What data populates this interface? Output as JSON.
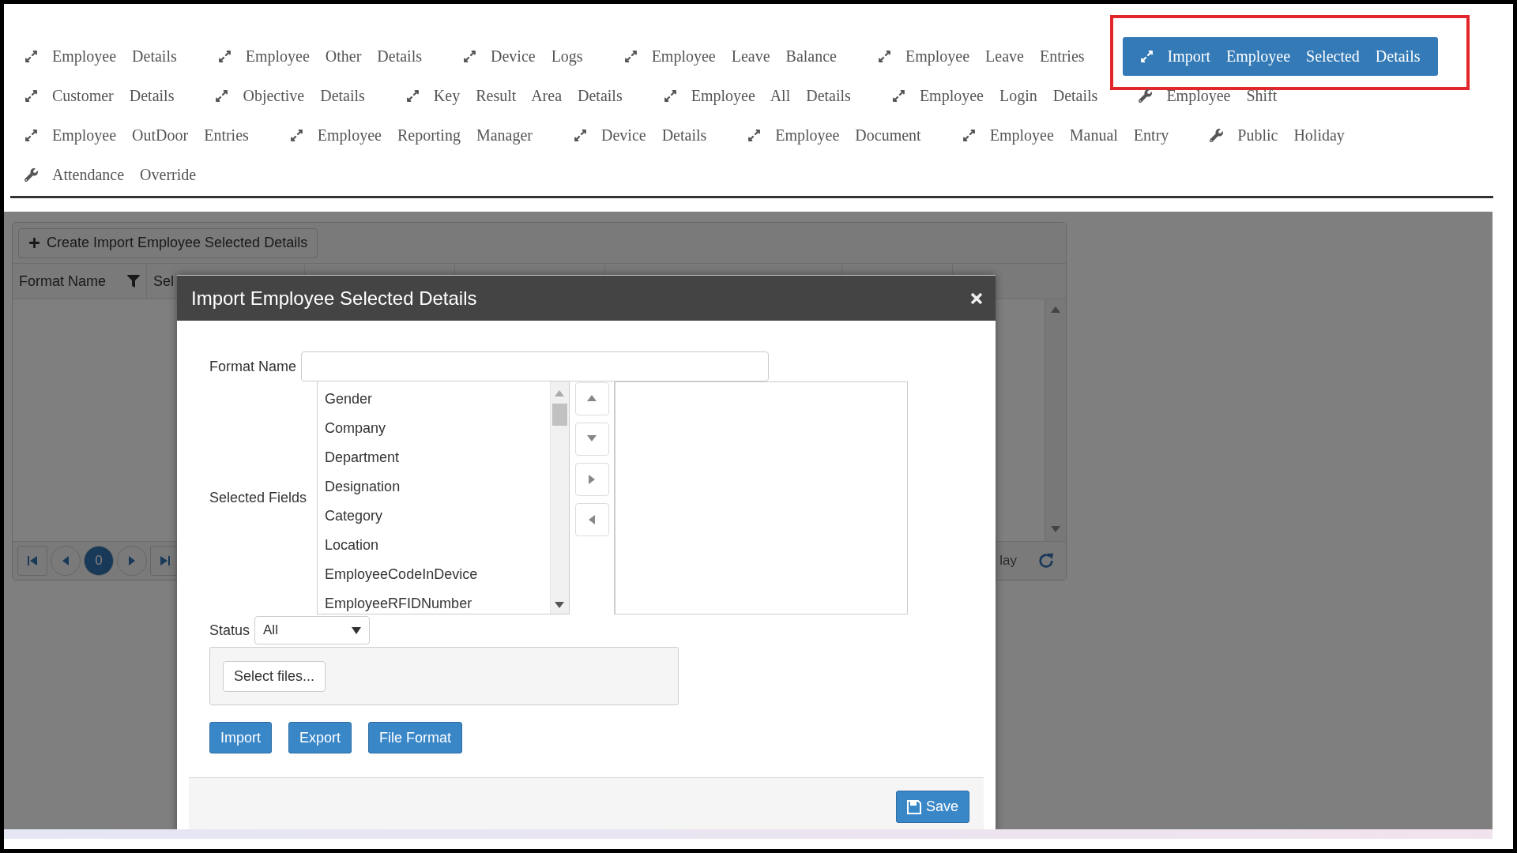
{
  "nav": {
    "rows": [
      [
        {
          "label": "Employee Details",
          "kind": "expand",
          "selected": false
        },
        {
          "label": "Employee Other Details",
          "kind": "expand",
          "selected": false
        },
        {
          "label": "Device Logs",
          "kind": "expand",
          "selected": false
        },
        {
          "label": "Employee Leave Balance",
          "kind": "expand",
          "selected": false
        },
        {
          "label": "Employee Leave Entries",
          "kind": "expand",
          "selected": false
        },
        {
          "label": "Import Employee Selected Details",
          "kind": "expand",
          "selected": true
        }
      ],
      [
        {
          "label": "Customer Details",
          "kind": "expand",
          "selected": false
        },
        {
          "label": "Objective Details",
          "kind": "expand",
          "selected": false
        },
        {
          "label": "Key Result Area Details",
          "kind": "expand",
          "selected": false
        },
        {
          "label": "Employee All Details",
          "kind": "expand",
          "selected": false
        },
        {
          "label": "Employee Login Details",
          "kind": "expand",
          "selected": false
        },
        {
          "label": "Employee Shift",
          "kind": "wrench",
          "selected": false
        }
      ],
      [
        {
          "label": "Employee OutDoor Entries",
          "kind": "expand",
          "selected": false
        },
        {
          "label": "Employee Reporting Manager",
          "kind": "expand",
          "selected": false
        },
        {
          "label": "Device Details",
          "kind": "expand",
          "selected": false
        },
        {
          "label": "Employee Document",
          "kind": "expand",
          "selected": false
        },
        {
          "label": "Employee Manual Entry",
          "kind": "expand",
          "selected": false
        },
        {
          "label": "Public Holiday",
          "kind": "wrench",
          "selected": false
        }
      ],
      [
        {
          "label": "Attendance Override",
          "kind": "wrench",
          "selected": false
        }
      ]
    ]
  },
  "grid": {
    "create_button": "Create Import Employee Selected Details",
    "columns": [
      "Format Name",
      "Sel"
    ],
    "pager": {
      "current": "0",
      "info": "lay"
    }
  },
  "modal": {
    "title": "Import Employee Selected Details",
    "format_name": {
      "label": "Format Name"
    },
    "selected_fields": {
      "label": "Selected Fields",
      "available": [
        "Gender",
        "Company",
        "Department",
        "Designation",
        "Category",
        "Location",
        "EmployeeCodeInDevice",
        "EmployeeRFIDNumber"
      ]
    },
    "status": {
      "label": "Status",
      "value": "All"
    },
    "upload": {
      "button": "Select files..."
    },
    "actions": [
      "Import",
      "Export",
      "File Format"
    ],
    "save": "Save"
  }
}
